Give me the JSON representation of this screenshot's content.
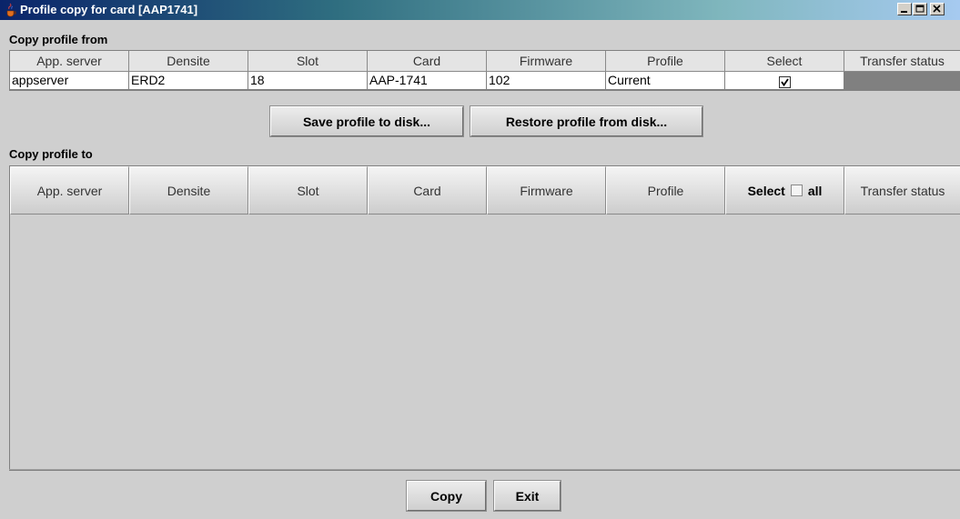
{
  "window": {
    "title": "Profile copy for card [AAP1741]",
    "icon": "java-cup-icon"
  },
  "from_section": {
    "label": "Copy profile from",
    "columns": [
      "App. server",
      "Densite",
      "Slot",
      "Card",
      "Firmware",
      "Profile",
      "Select",
      "Transfer status"
    ],
    "row": {
      "app_server": "appserver",
      "densite": "ERD2",
      "slot": "18",
      "card": "AAP-1741",
      "firmware": "102",
      "profile": "Current",
      "selected": true,
      "transfer_status": ""
    }
  },
  "actions": {
    "save_label": "Save profile to disk...",
    "restore_label": "Restore profile from disk..."
  },
  "to_section": {
    "label": "Copy profile to",
    "columns": [
      "App. server",
      "Densite",
      "Slot",
      "Card",
      "Firmware",
      "Profile",
      "Select",
      "Transfer status"
    ],
    "select_all_label": "all",
    "select_all_checked": false
  },
  "footer": {
    "copy_label": "Copy",
    "exit_label": "Exit"
  },
  "colors": {
    "status_cell": "#808080",
    "title_start": "#0a246a",
    "title_end": "#a6caf0"
  }
}
